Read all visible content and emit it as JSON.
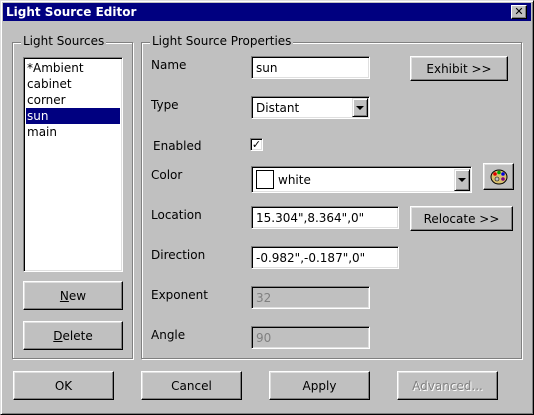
{
  "window": {
    "title": "Light Source Editor",
    "close_glyph": "✕"
  },
  "light_sources": {
    "group_label": "Light Sources",
    "items": [
      "*Ambient",
      "cabinet",
      "corner",
      "sun",
      "main"
    ],
    "selected": "sun",
    "new_label_u": "N",
    "new_label_rest": "ew",
    "delete_label_u": "D",
    "delete_label_rest": "elete"
  },
  "properties": {
    "group_label": "Light Source Properties",
    "name_label": "Name",
    "name_value": "sun",
    "exhibit_label": "Exhibit >>",
    "type_label": "Type",
    "type_value": "Distant",
    "enabled_label": "Enabled",
    "enabled_checked": true,
    "check_glyph": "✓",
    "color_label": "Color",
    "color_value": "white",
    "color_swatch": "#ffffff",
    "palette_icon": "palette-icon",
    "location_label": "Location",
    "location_value": "15.304\",8.364\",0\"",
    "relocate_label": "Relocate >>",
    "direction_label": "Direction",
    "direction_value": "-0.982\",-0.187\",0\"",
    "exponent_label": "Exponent",
    "exponent_value": "32",
    "angle_label": "Angle",
    "angle_value": "90"
  },
  "footer": {
    "ok_label": "OK",
    "cancel_label": "Cancel",
    "apply_label": "Apply",
    "advanced_label": "Advanced..."
  },
  "colors": {
    "titlebar": "#000080",
    "face": "#c0c0c0",
    "selection": "#000080"
  }
}
